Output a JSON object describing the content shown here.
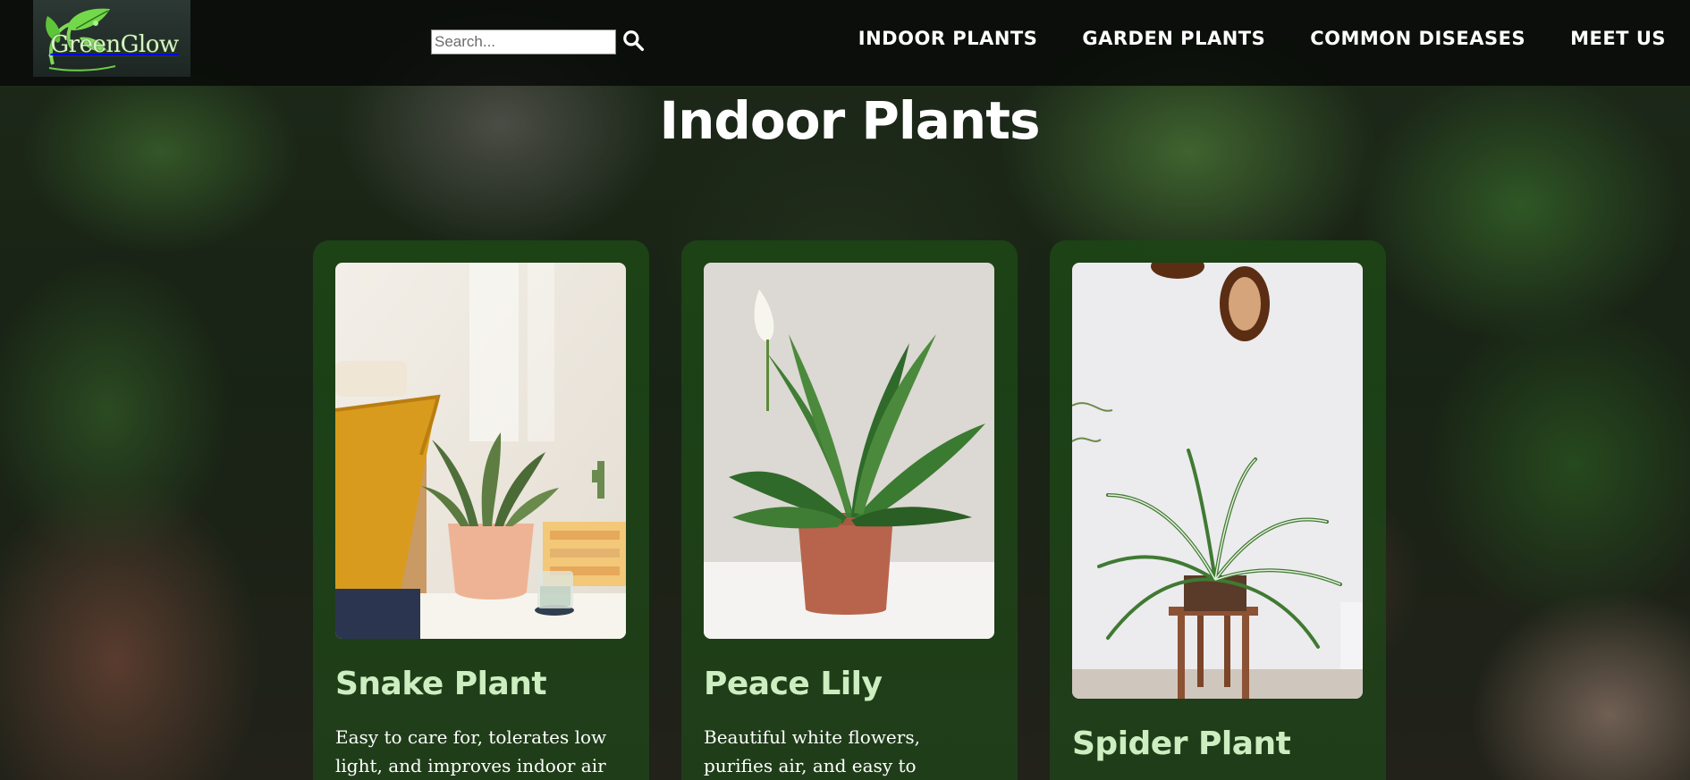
{
  "brand": {
    "name": "GreenGlow"
  },
  "search": {
    "placeholder": "Search..."
  },
  "nav": [
    {
      "label": "INDOOR PLANTS"
    },
    {
      "label": "GARDEN PLANTS"
    },
    {
      "label": "COMMON DISEASES"
    },
    {
      "label": "MEET US"
    }
  ],
  "page": {
    "title": "Indoor Plants"
  },
  "cards": [
    {
      "name": "Snake Plant",
      "description": "Easy to care for, tolerates low light, and improves indoor air"
    },
    {
      "name": "Peace Lily",
      "description": "Beautiful white flowers, purifies air, and easy to maintain."
    },
    {
      "name": "Spider Plant",
      "description": ""
    }
  ],
  "colors": {
    "header_bg": "#080a08",
    "card_bg": "#1c4416",
    "card_title": "#cdeec0",
    "text": "#ffffff"
  },
  "icons": {
    "search": "search-icon",
    "logo": "leaf-logo-icon"
  }
}
